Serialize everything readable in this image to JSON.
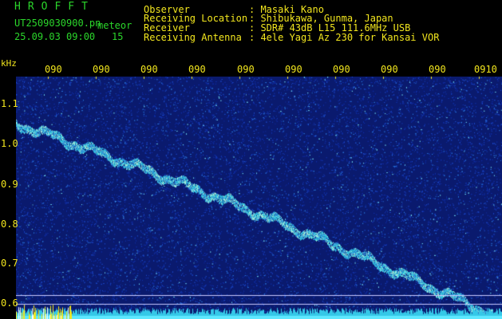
{
  "header": {
    "app_title": "HROFFT",
    "file_name": "UT2509030900.pn",
    "file_sub": "meteor",
    "datetime": "25.09.03 09:00",
    "count": "15",
    "info_labels": [
      "Observer",
      "Receiving Location",
      "Receiver",
      "Receiving Antenna"
    ],
    "info_values": [
      ": Masaki Kano",
      ": Shibukawa, Gunma, Japan",
      ": SDR# 43dB L15 111.6MHz USB",
      ": 4ele Yagi Az 230 for Kansai VOR"
    ]
  },
  "axes": {
    "freq_unit": "kHz",
    "freq_ticks": [
      "1.1",
      "1.0",
      "0.9",
      "0.8",
      "0.7",
      "0.6"
    ],
    "time_ticks": [
      "090",
      "090",
      "090",
      "090",
      "090",
      "090",
      "090",
      "090",
      "090",
      "0910"
    ]
  },
  "spectrogram": {
    "freq_range_khz": [
      0.58,
      1.15
    ],
    "trace_start_khz": 1.04,
    "trace_end_khz": 0.59
  },
  "colors": {
    "background": "#0a1a6e",
    "label_yellow": "#f2e61e",
    "title_green": "#2bd62b",
    "signal": "#30c8e0"
  }
}
